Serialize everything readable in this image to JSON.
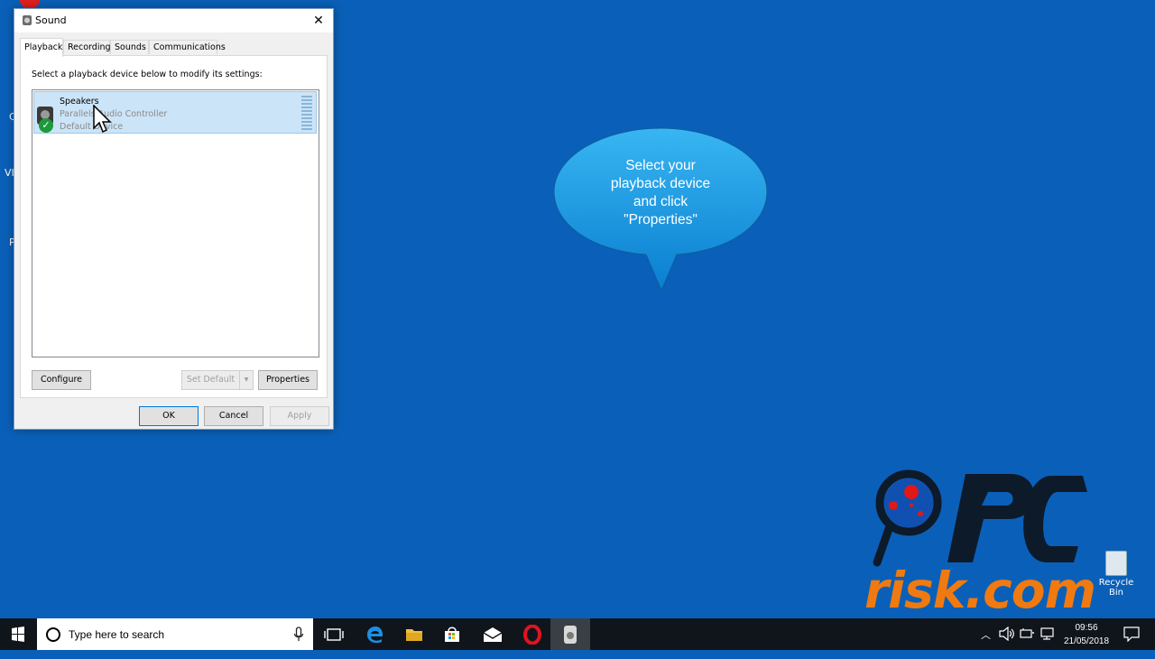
{
  "desktop_edge_letters": [
    "C",
    "VI",
    "P"
  ],
  "dialog": {
    "title": "Sound",
    "close": "✕",
    "tabs": [
      "Playback",
      "Recording",
      "Sounds",
      "Communications"
    ],
    "instruction": "Select a playback device below to modify its settings:",
    "device": {
      "name": "Speakers",
      "controller": "Parallels Audio Controller",
      "status": "Default Device"
    },
    "buttons": {
      "configure": "Configure",
      "set_default": "Set Default",
      "properties": "Properties",
      "ok": "OK",
      "cancel": "Cancel",
      "apply": "Apply"
    }
  },
  "callout": {
    "text_lines": [
      "Select your",
      "playback device",
      "and click",
      "\"Properties\""
    ]
  },
  "watermark": {
    "line2": "risk.com"
  },
  "recycle_bin": {
    "label": "Recycle Bin"
  },
  "taskbar": {
    "search_placeholder": "Type here to search",
    "clock_time": "09:56",
    "clock_date": "21/05/2018"
  },
  "colors": {
    "desktop": "#0a60b8",
    "selection": "#cce4f7",
    "accent": "#0078d7",
    "watermark_orange": "#f07a10",
    "callout_blue": "#1a9fe6"
  }
}
